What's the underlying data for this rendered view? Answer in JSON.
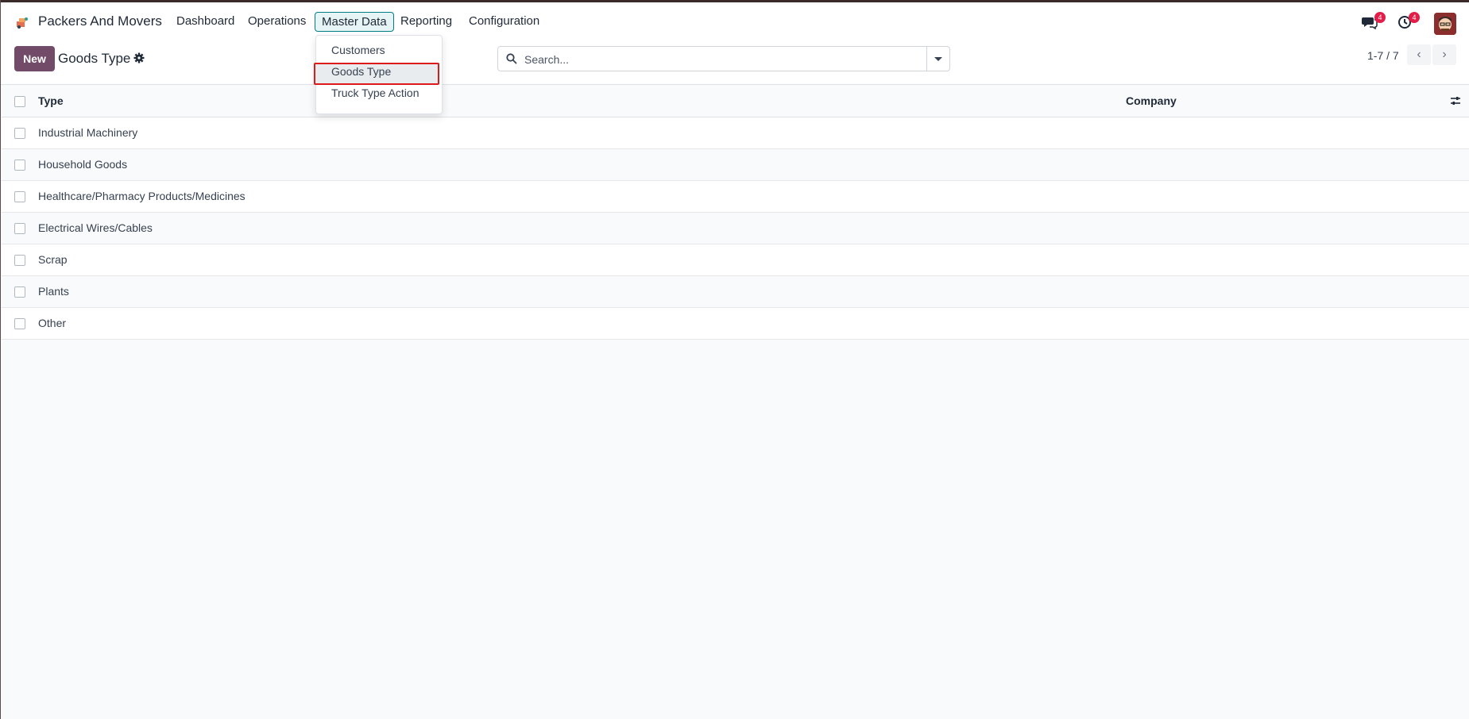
{
  "navbar": {
    "app_name": "Packers And Movers",
    "menu": [
      "Dashboard",
      "Operations",
      "Master Data",
      "Reporting",
      "Configuration"
    ],
    "active_menu": "Master Data",
    "messages_badge": "4",
    "activities_badge": "4"
  },
  "dropdown": {
    "items": [
      "Customers",
      "Goods Type",
      "Truck Type Action"
    ],
    "selected": "Goods Type"
  },
  "control_panel": {
    "new_label": "New",
    "title": "Goods Type",
    "search_placeholder": "Search...",
    "pager": "1-7 / 7"
  },
  "table": {
    "columns": [
      "Type",
      "Company"
    ],
    "rows": [
      {
        "type": "Industrial Machinery",
        "company": ""
      },
      {
        "type": "Household Goods",
        "company": ""
      },
      {
        "type": "Healthcare/Pharmacy Products/Medicines",
        "company": ""
      },
      {
        "type": "Electrical Wires/Cables",
        "company": ""
      },
      {
        "type": "Scrap",
        "company": ""
      },
      {
        "type": "Plants",
        "company": ""
      },
      {
        "type": "Other",
        "company": ""
      }
    ]
  },
  "colors": {
    "primary": "#714b67",
    "active_menu_border": "#017e84",
    "badge": "#e11d48",
    "highlight_border": "#dc1a1a"
  }
}
